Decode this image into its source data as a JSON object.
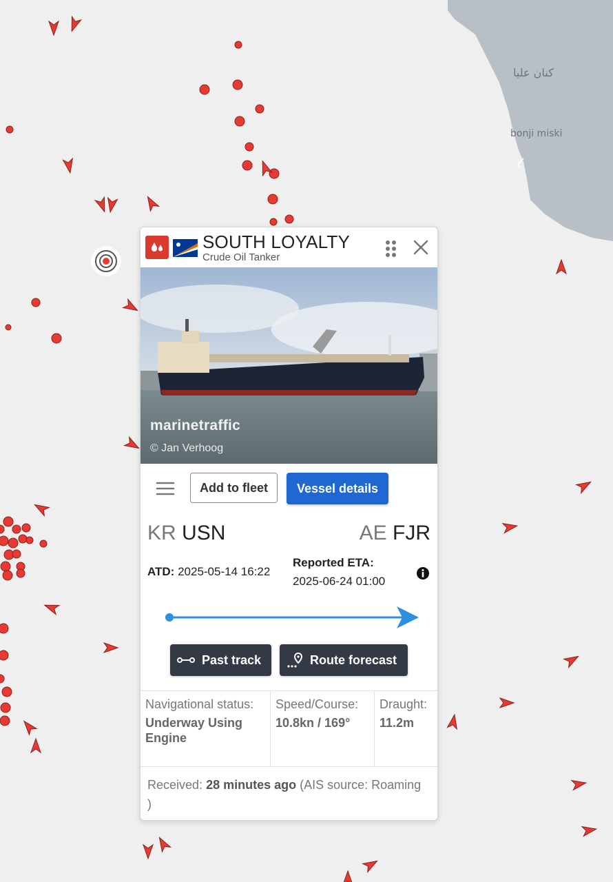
{
  "map": {
    "land_labels": [
      "كنان عليا",
      "bonji miski"
    ],
    "colors": {
      "water": "#efefef",
      "land": "#b9bfc7",
      "vessel_marker": "#e63a32"
    }
  },
  "vessel": {
    "name": "SOUTH LOYALTY",
    "type": "Crude Oil Tanker",
    "type_icon": "tanker-icon",
    "flag_icon": "marshall-islands-flag"
  },
  "photo": {
    "watermark": "marinetraffic",
    "credit": "© Jan Verhoog"
  },
  "actions": {
    "menu_icon": "hamburger-menu-icon",
    "add_to_fleet": "Add to fleet",
    "vessel_details": "Vessel details"
  },
  "voyage": {
    "departure": {
      "country": "KR",
      "port": "USN"
    },
    "arrival": {
      "country": "AE",
      "port": "FJR"
    },
    "atd_label": "ATD:",
    "atd_value": "2025-05-14 16:22",
    "eta_label": "Reported ETA:",
    "eta_value": "2025-06-24 01:00",
    "progress_fraction": 1.0,
    "progress_color": "#2d8fdd"
  },
  "track_buttons": {
    "past_track": "Past track",
    "route_forecast": "Route forecast"
  },
  "status": {
    "nav_label": "Navigational status:",
    "nav_value": "Underway Using Engine",
    "speed_label": "Speed/Course:",
    "speed_value": "10.8kn / 169°",
    "draught_label": "Draught:",
    "draught_value": "11.2m"
  },
  "received": {
    "label": "Received:",
    "value": "28 minutes ago",
    "source": "(AIS source: Roaming )"
  }
}
